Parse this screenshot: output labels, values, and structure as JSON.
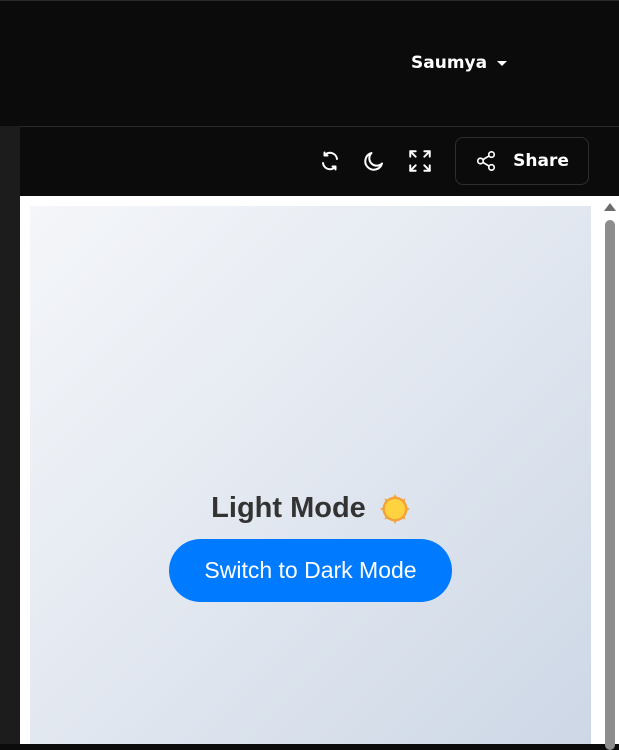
{
  "header": {
    "user_name": "Saumya"
  },
  "toolbar": {
    "icons": [
      "refresh-icon",
      "moon-icon",
      "fullscreen-icon"
    ],
    "share_label": "Share"
  },
  "preview": {
    "heading": "Light Mode",
    "heading_icon": "sun-icon",
    "button_label": "Switch to Dark Mode",
    "accent_color": "#007bff"
  }
}
